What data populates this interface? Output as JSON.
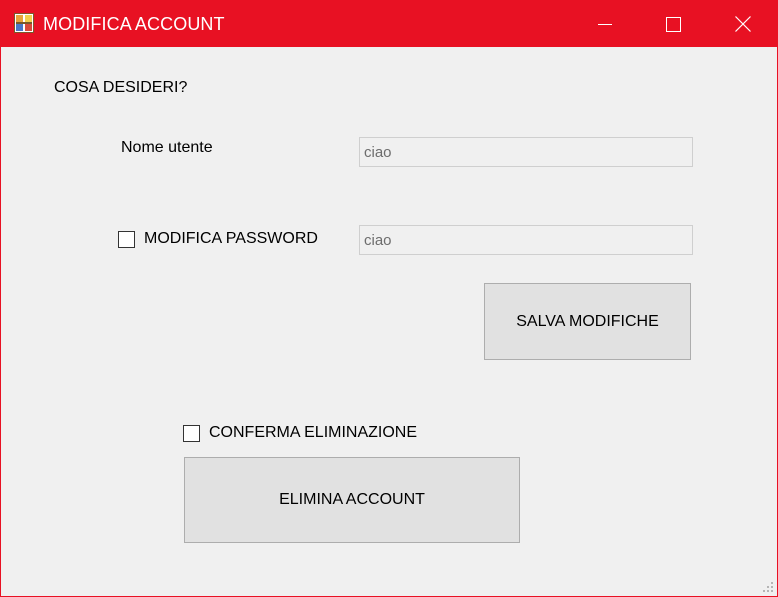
{
  "window": {
    "title": "MODIFICA ACCOUNT",
    "titlebar_color": "#e81123",
    "background": "#f0f0f0",
    "controls": [
      "minimize-icon",
      "maximize-icon",
      "close-icon"
    ]
  },
  "form": {
    "prompt": "COSA DESIDERI?",
    "username_label": "Nome utente",
    "username_value": "ciao",
    "change_password_label": "MODIFICA PASSWORD",
    "change_password_checked": false,
    "password_value": "ciao",
    "save_button": "SALVA MODIFICHE",
    "confirm_delete_label": "CONFERMA ELIMINAZIONE",
    "confirm_delete_checked": false,
    "delete_button": "ELIMINA ACCOUNT"
  }
}
